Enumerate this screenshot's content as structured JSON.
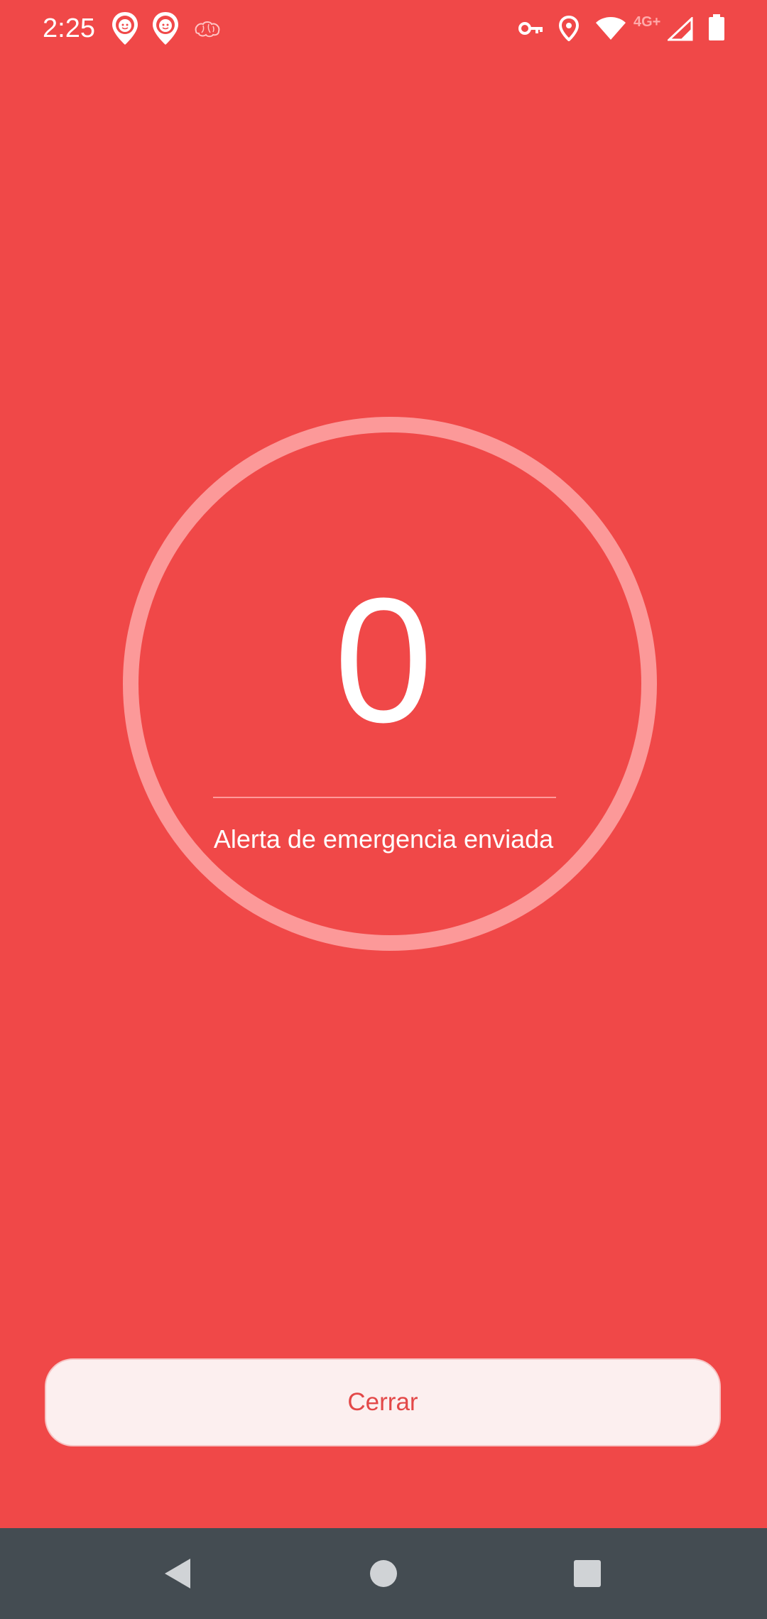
{
  "status_bar": {
    "time": "2:25",
    "network_type": "4G+",
    "left_icons": [
      "kid-location-pin-icon",
      "kid-location-pin-icon",
      "brain-icon"
    ],
    "right_icons": [
      "vpn-key-icon",
      "location-pin-icon",
      "wifi-icon",
      "cell-signal-icon",
      "battery-icon"
    ]
  },
  "alert": {
    "countdown": "0",
    "message": "Alerta de emergencia enviada"
  },
  "actions": {
    "close_label": "Cerrar"
  },
  "nav_bar": {
    "buttons": [
      "back-icon",
      "home-icon",
      "recents-icon"
    ]
  },
  "colors": {
    "background": "#F04848",
    "ring": "#FC9999",
    "button_bg": "#FCEFEF",
    "button_text": "#E34848",
    "nav_bar": "#444C52"
  }
}
